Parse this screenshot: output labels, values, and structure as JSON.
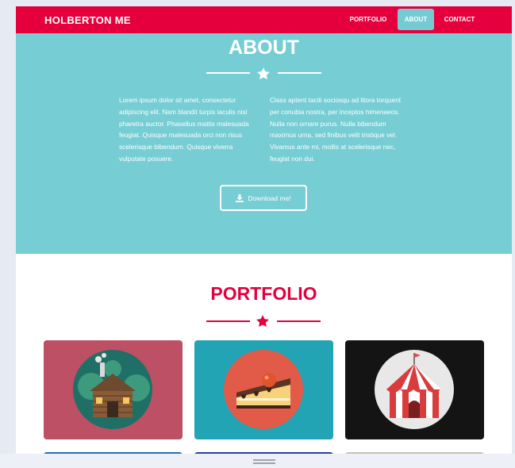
{
  "colors": {
    "brand": "#e5003d",
    "teal": "#76cdd3",
    "active": "#74cbd2"
  },
  "navbar": {
    "brand": "HOLBERTON ME",
    "links": [
      "PORTFOLIO",
      "ABOUT",
      "CONTACT"
    ],
    "active": "ABOUT"
  },
  "about": {
    "title": "ABOUT",
    "divider_icon": "star-icon",
    "col1": "Lorem ipsum dolor sit amet, consectetur adipiscing elit. Nam blandit turpis iaculis nisl pharetra auctor. Phasellus mattis malesuada feugiat. Quisque malesuada orci non risus scelerisque bibendum. Quisque viverra vulputate posuere.",
    "col2": "Class aptent taciti sociosqu ad litora torquent per conubia nostra, per inceptos himenaeos. Nulla non ornare purus. Nulla bibendum maximus urna, sed finibus velit tristique vel. Vivamus ante mi, mollis at scelerisque nec, feugiat non dui.",
    "download_label": "Download me!",
    "download_icon": "download-icon"
  },
  "portfolio": {
    "title": "PORTFOLIO",
    "divider_icon": "star-icon",
    "items": [
      {
        "name": "cabin",
        "icon": "cabin-icon",
        "bg": "#bd5064"
      },
      {
        "name": "cake",
        "icon": "cake-icon",
        "bg": "#23a4b4"
      },
      {
        "name": "circus",
        "icon": "circus-tent-icon",
        "bg": "#141414"
      }
    ],
    "next_row_colors": [
      "#2b6fb3",
      "#2b3f9c",
      "#ccbfb0"
    ]
  }
}
